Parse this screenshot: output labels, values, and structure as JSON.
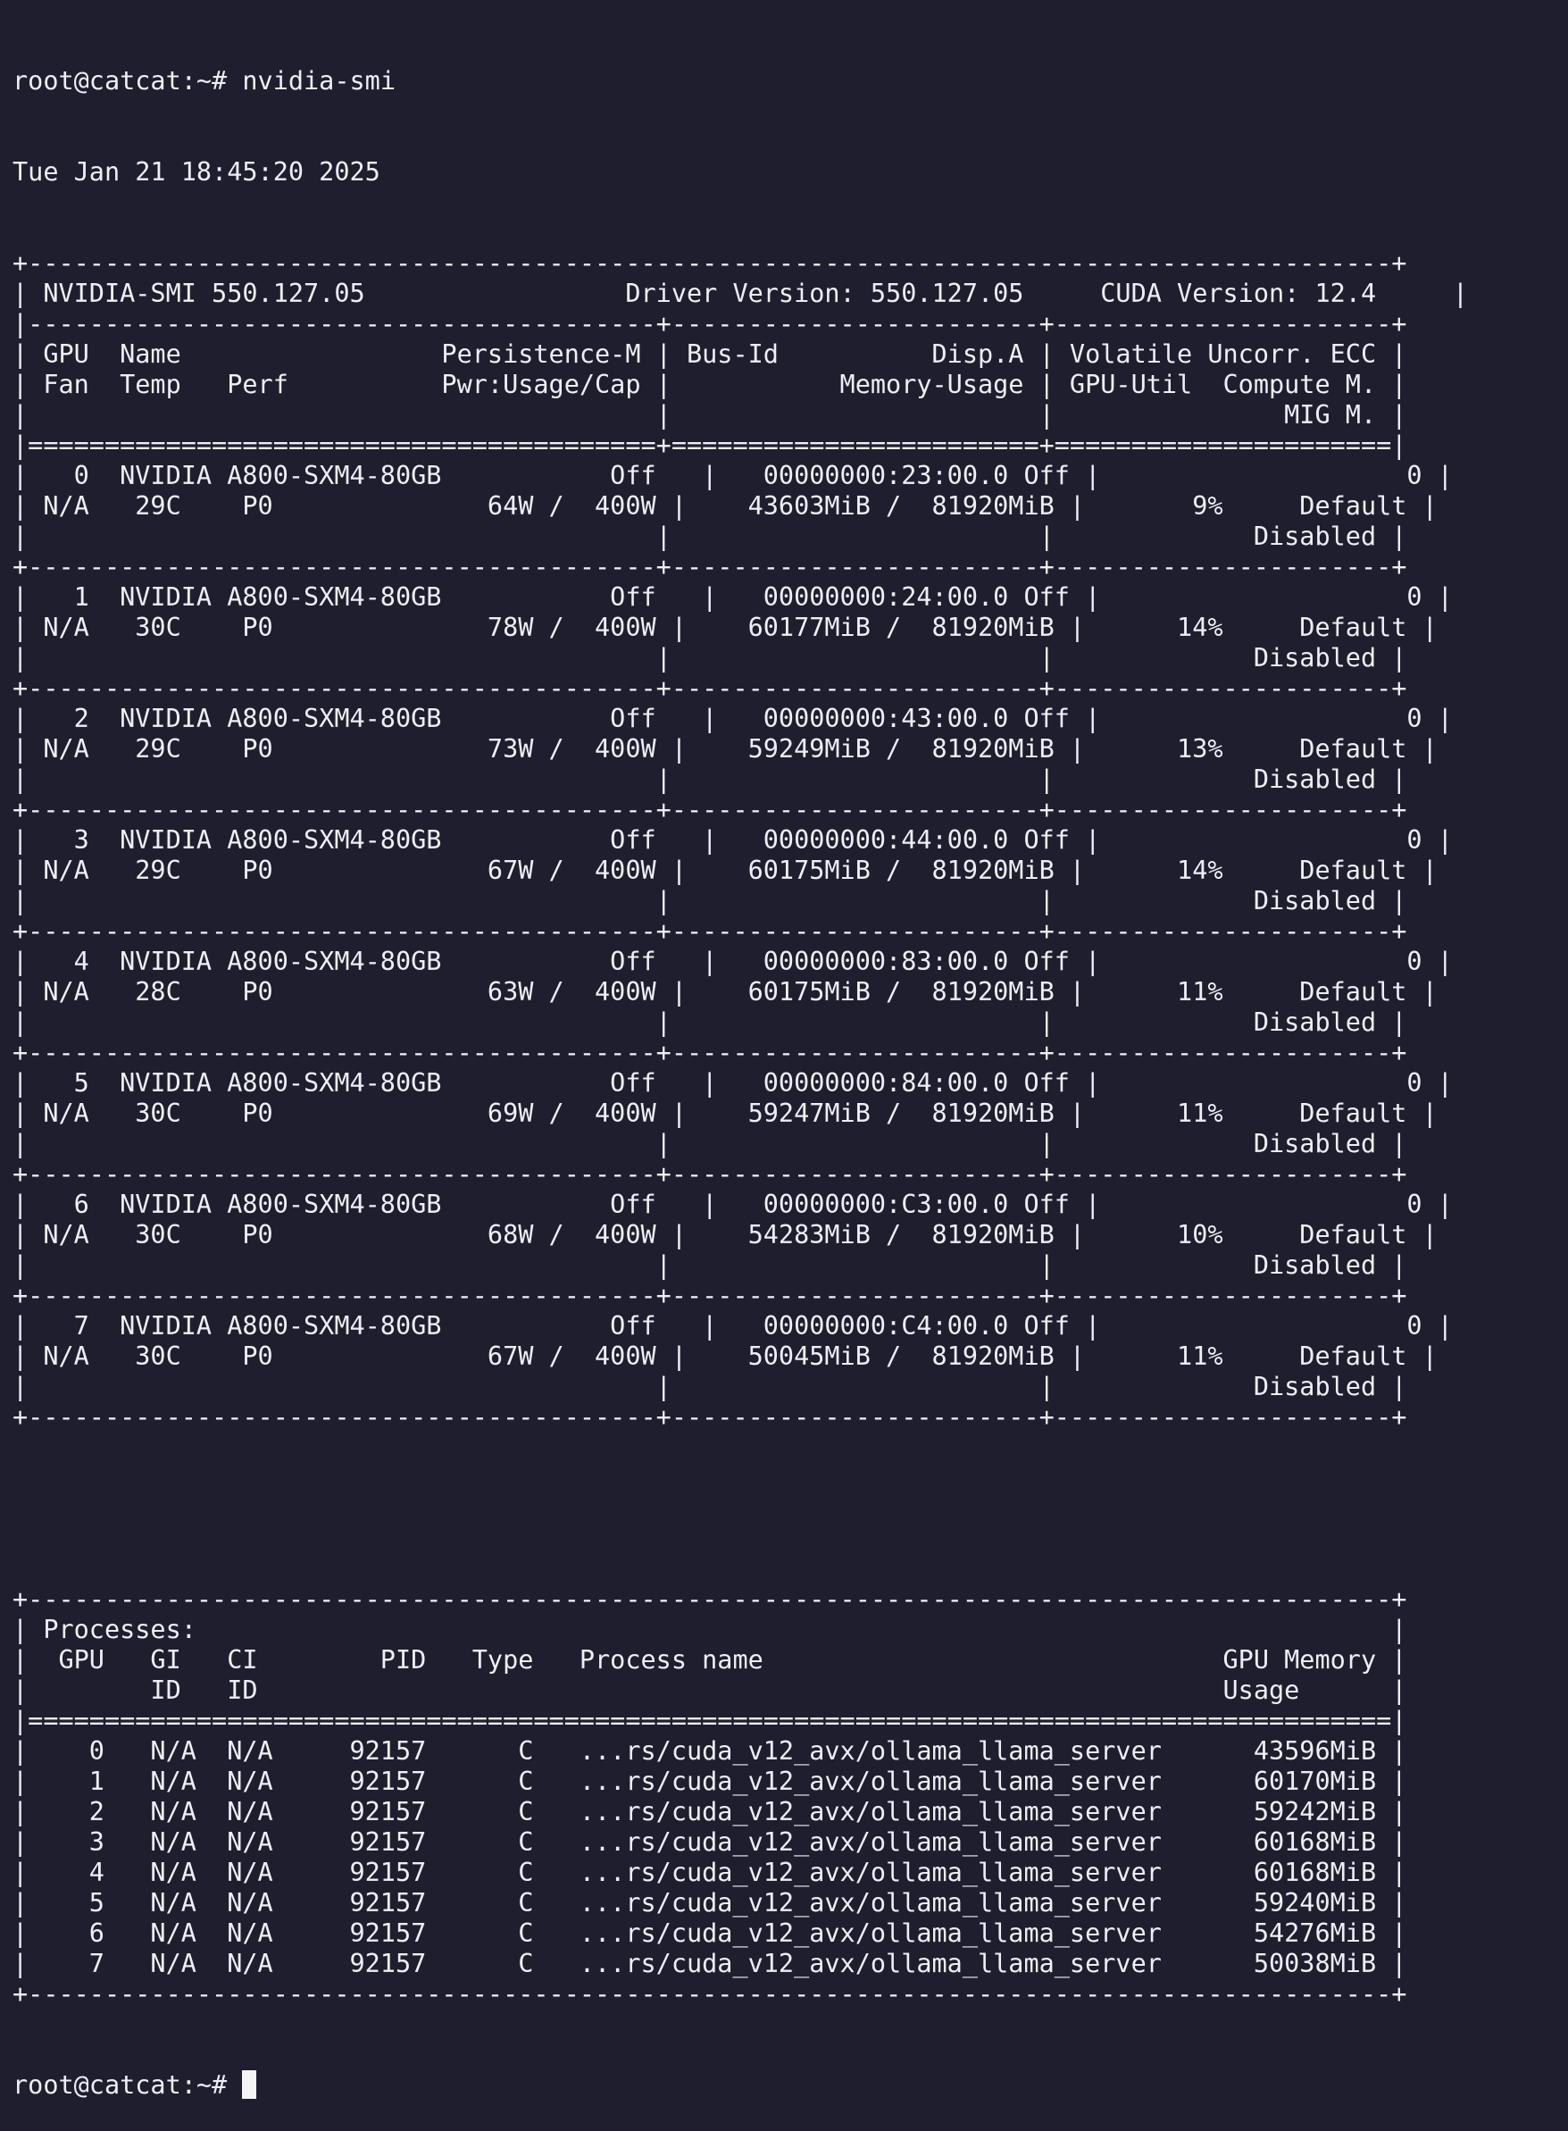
{
  "prompt": "root@catcat:~# ",
  "command": "nvidia-smi",
  "timestamp": "Tue Jan 21 18:45:20 2025",
  "smi_header": {
    "smi_version": "550.127.05",
    "driver_version": "550.127.05",
    "cuda_version": "12.4"
  },
  "gpus": [
    {
      "index": "0",
      "name": "NVIDIA A800-SXM4-80GB",
      "persistence": "Off",
      "bus_id": "00000000:23:00.0",
      "disp_a": "Off",
      "volatile_ecc": "0",
      "fan": "N/A",
      "temp": "29C",
      "perf": "P0",
      "pwr_usage": "64W",
      "pwr_cap": "400W",
      "mem_used": "43603MiB",
      "mem_total": "81920MiB",
      "gpu_util": "9%",
      "compute_mode": "Default",
      "mig_mode": "Disabled"
    },
    {
      "index": "1",
      "name": "NVIDIA A800-SXM4-80GB",
      "persistence": "Off",
      "bus_id": "00000000:24:00.0",
      "disp_a": "Off",
      "volatile_ecc": "0",
      "fan": "N/A",
      "temp": "30C",
      "perf": "P0",
      "pwr_usage": "78W",
      "pwr_cap": "400W",
      "mem_used": "60177MiB",
      "mem_total": "81920MiB",
      "gpu_util": "14%",
      "compute_mode": "Default",
      "mig_mode": "Disabled"
    },
    {
      "index": "2",
      "name": "NVIDIA A800-SXM4-80GB",
      "persistence": "Off",
      "bus_id": "00000000:43:00.0",
      "disp_a": "Off",
      "volatile_ecc": "0",
      "fan": "N/A",
      "temp": "29C",
      "perf": "P0",
      "pwr_usage": "73W",
      "pwr_cap": "400W",
      "mem_used": "59249MiB",
      "mem_total": "81920MiB",
      "gpu_util": "13%",
      "compute_mode": "Default",
      "mig_mode": "Disabled"
    },
    {
      "index": "3",
      "name": "NVIDIA A800-SXM4-80GB",
      "persistence": "Off",
      "bus_id": "00000000:44:00.0",
      "disp_a": "Off",
      "volatile_ecc": "0",
      "fan": "N/A",
      "temp": "29C",
      "perf": "P0",
      "pwr_usage": "67W",
      "pwr_cap": "400W",
      "mem_used": "60175MiB",
      "mem_total": "81920MiB",
      "gpu_util": "14%",
      "compute_mode": "Default",
      "mig_mode": "Disabled"
    },
    {
      "index": "4",
      "name": "NVIDIA A800-SXM4-80GB",
      "persistence": "Off",
      "bus_id": "00000000:83:00.0",
      "disp_a": "Off",
      "volatile_ecc": "0",
      "fan": "N/A",
      "temp": "28C",
      "perf": "P0",
      "pwr_usage": "63W",
      "pwr_cap": "400W",
      "mem_used": "60175MiB",
      "mem_total": "81920MiB",
      "gpu_util": "11%",
      "compute_mode": "Default",
      "mig_mode": "Disabled"
    },
    {
      "index": "5",
      "name": "NVIDIA A800-SXM4-80GB",
      "persistence": "Off",
      "bus_id": "00000000:84:00.0",
      "disp_a": "Off",
      "volatile_ecc": "0",
      "fan": "N/A",
      "temp": "30C",
      "perf": "P0",
      "pwr_usage": "69W",
      "pwr_cap": "400W",
      "mem_used": "59247MiB",
      "mem_total": "81920MiB",
      "gpu_util": "11%",
      "compute_mode": "Default",
      "mig_mode": "Disabled"
    },
    {
      "index": "6",
      "name": "NVIDIA A800-SXM4-80GB",
      "persistence": "Off",
      "bus_id": "00000000:C3:00.0",
      "disp_a": "Off",
      "volatile_ecc": "0",
      "fan": "N/A",
      "temp": "30C",
      "perf": "P0",
      "pwr_usage": "68W",
      "pwr_cap": "400W",
      "mem_used": "54283MiB",
      "mem_total": "81920MiB",
      "gpu_util": "10%",
      "compute_mode": "Default",
      "mig_mode": "Disabled"
    },
    {
      "index": "7",
      "name": "NVIDIA A800-SXM4-80GB",
      "persistence": "Off",
      "bus_id": "00000000:C4:00.0",
      "disp_a": "Off",
      "volatile_ecc": "0",
      "fan": "N/A",
      "temp": "30C",
      "perf": "P0",
      "pwr_usage": "67W",
      "pwr_cap": "400W",
      "mem_used": "50045MiB",
      "mem_total": "81920MiB",
      "gpu_util": "11%",
      "compute_mode": "Default",
      "mig_mode": "Disabled"
    }
  ],
  "processes": [
    {
      "gpu": "0",
      "gi_id": "N/A",
      "ci_id": "N/A",
      "pid": "92157",
      "type": "C",
      "name": "...rs/cuda_v12_avx/ollama_llama_server",
      "memory": "43596MiB"
    },
    {
      "gpu": "1",
      "gi_id": "N/A",
      "ci_id": "N/A",
      "pid": "92157",
      "type": "C",
      "name": "...rs/cuda_v12_avx/ollama_llama_server",
      "memory": "60170MiB"
    },
    {
      "gpu": "2",
      "gi_id": "N/A",
      "ci_id": "N/A",
      "pid": "92157",
      "type": "C",
      "name": "...rs/cuda_v12_avx/ollama_llama_server",
      "memory": "59242MiB"
    },
    {
      "gpu": "3",
      "gi_id": "N/A",
      "ci_id": "N/A",
      "pid": "92157",
      "type": "C",
      "name": "...rs/cuda_v12_avx/ollama_llama_server",
      "memory": "60168MiB"
    },
    {
      "gpu": "4",
      "gi_id": "N/A",
      "ci_id": "N/A",
      "pid": "92157",
      "type": "C",
      "name": "...rs/cuda_v12_avx/ollama_llama_server",
      "memory": "60168MiB"
    },
    {
      "gpu": "5",
      "gi_id": "N/A",
      "ci_id": "N/A",
      "pid": "92157",
      "type": "C",
      "name": "...rs/cuda_v12_avx/ollama_llama_server",
      "memory": "59240MiB"
    },
    {
      "gpu": "6",
      "gi_id": "N/A",
      "ci_id": "N/A",
      "pid": "92157",
      "type": "C",
      "name": "...rs/cuda_v12_avx/ollama_llama_server",
      "memory": "54276MiB"
    },
    {
      "gpu": "7",
      "gi_id": "N/A",
      "ci_id": "N/A",
      "pid": "92157",
      "type": "C",
      "name": "...rs/cuda_v12_avx/ollama_llama_server",
      "memory": "50038MiB"
    }
  ]
}
